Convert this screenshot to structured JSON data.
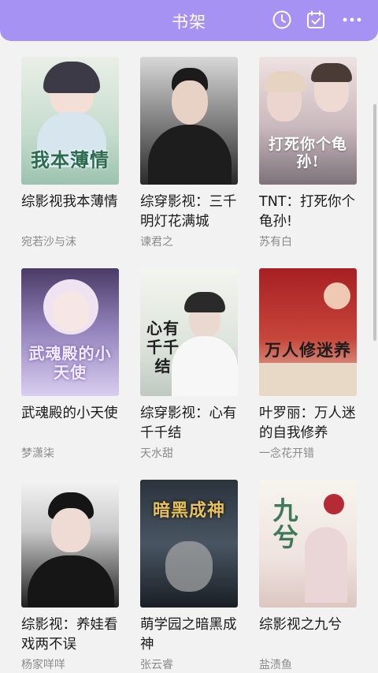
{
  "header": {
    "title": "书架",
    "icons": [
      "history-clock-icon",
      "calendar-check-icon",
      "more-dots-icon"
    ],
    "background": "#a592f3"
  },
  "books": [
    {
      "title": "综影视我本薄情",
      "author": "宛若沙与沫",
      "cover_text": "我本薄情",
      "cover_bg": [
        "#dfe8df",
        "#a9c7b9"
      ],
      "cover_text_color": "#2c6b50"
    },
    {
      "title": "综穿影视：三千明灯花满城",
      "author": "谏君之",
      "cover_text": "",
      "cover_bg": [
        "#cfcfcf",
        "#2a2a2a"
      ],
      "cover_text_color": "#ffffff"
    },
    {
      "title": "TNT：打死你个龟孙!",
      "author": "苏有白",
      "cover_text": "打死你个龟孙!",
      "cover_bg": [
        "#e6d4d6",
        "#9a8b92"
      ],
      "cover_text_color": "#ffffff"
    },
    {
      "title": "武魂殿的小天使",
      "author": "梦潇柒",
      "cover_text": "武魂殿的小天使",
      "cover_bg": [
        "#5a4a7a",
        "#c7b5e6"
      ],
      "cover_text_color": "#f2ecff"
    },
    {
      "title": "综穿影视：心有千千结",
      "author": "天水甜",
      "cover_text": "心有千千结",
      "cover_bg": [
        "#eef2e8",
        "#cfd8cf"
      ],
      "cover_text_color": "#2a2a2a"
    },
    {
      "title": "叶罗丽：万人迷的自我修养",
      "author": "一念花开错",
      "cover_text": "万人修迷养",
      "cover_bg": [
        "#b3262a",
        "#e9d7c5"
      ],
      "cover_text_color": "#1c1c1c"
    },
    {
      "title": "综影视：养娃看戏两不误",
      "author": "杨家咩咩",
      "cover_text": "",
      "cover_bg": [
        "#efefef",
        "#1e1e1e"
      ],
      "cover_text_color": "#ffffff"
    },
    {
      "title": "萌学园之暗黑成神",
      "author": "张云睿",
      "cover_text": "暗黑成神",
      "cover_bg": [
        "#232a33",
        "#5d6b7a"
      ],
      "cover_text_color": "#e7c15a"
    },
    {
      "title": "综影视之九兮",
      "author": "盐渍鱼",
      "cover_text": "九兮",
      "cover_bg": [
        "#f3f0ea",
        "#e4cfc9"
      ],
      "cover_text_color": "#3f7a58"
    }
  ]
}
